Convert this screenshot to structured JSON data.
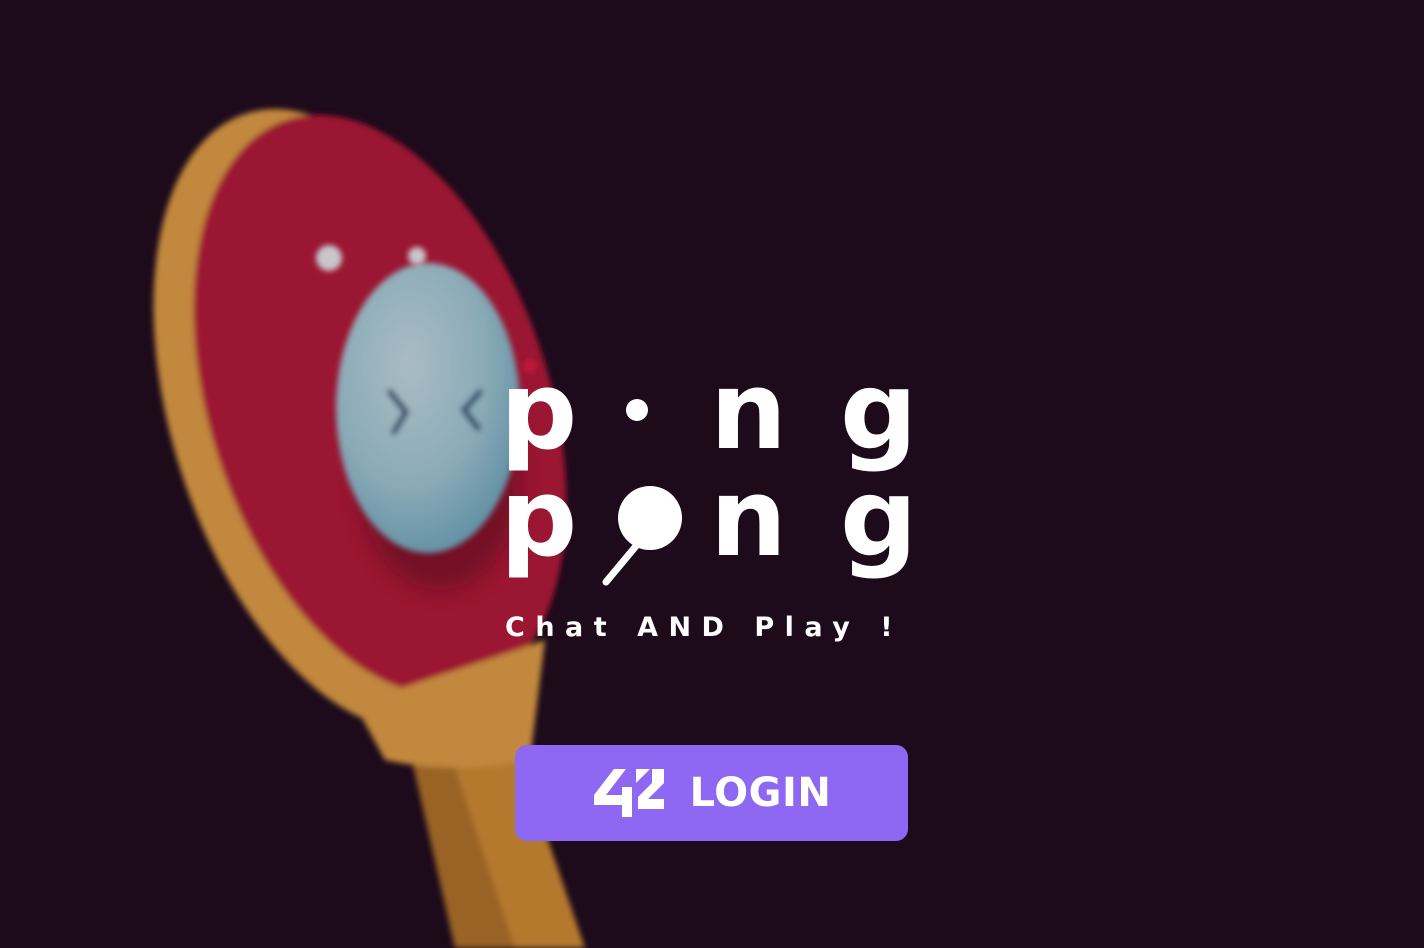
{
  "logo": {
    "line1": [
      "p",
      "n",
      "g"
    ],
    "line2": [
      "p",
      "n",
      "g"
    ]
  },
  "tagline": "Chat AND Play !",
  "login_button": {
    "brand": "42",
    "label": "LOGIN"
  },
  "colors": {
    "background": "#1d0b1c",
    "paddle_face": "#9b1533",
    "paddle_wood": "#c98a3c",
    "ball": "#8fb2c0",
    "button": "#8e67f2",
    "text": "#ffffff"
  },
  "icons": [
    "paddle-illustration",
    "ping-pong-ball-icon",
    "42-logo-icon"
  ]
}
